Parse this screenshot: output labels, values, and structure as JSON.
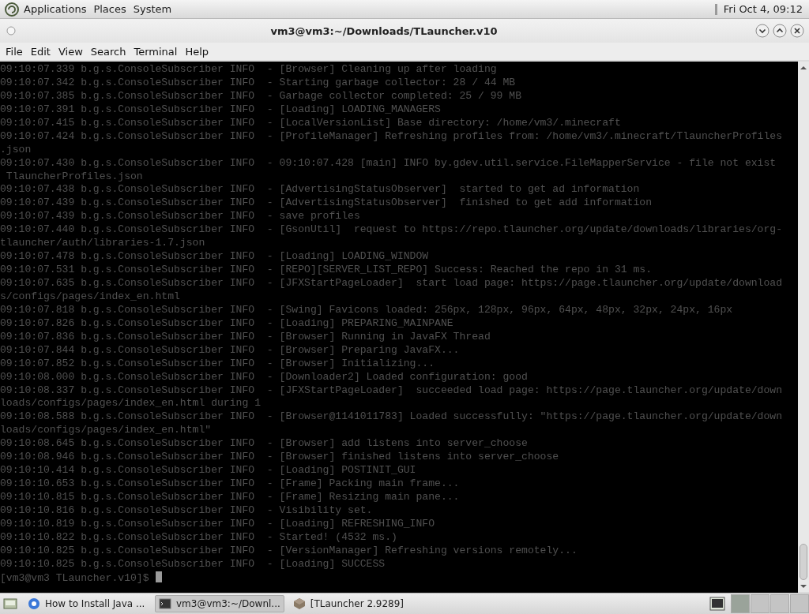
{
  "top_panel": {
    "menus": [
      "Applications",
      "Places",
      "System"
    ],
    "clock": "Fri Oct  4, 09:12"
  },
  "window": {
    "title": "vm3@vm3:~/Downloads/TLauncher.v10",
    "menu": [
      "File",
      "Edit",
      "View",
      "Search",
      "Terminal",
      "Help"
    ],
    "terminal": {
      "lines": [
        "09:10:07.339 b.g.s.ConsoleSubscriber INFO  - [Browser] Cleaning up after loading",
        "09:10:07.342 b.g.s.ConsoleSubscriber INFO  - Starting garbage collector: 28 / 44 MB",
        "09:10:07.385 b.g.s.ConsoleSubscriber INFO  - Garbage collector completed: 25 / 99 MB",
        "09:10:07.391 b.g.s.ConsoleSubscriber INFO  - [Loading] LOADING_MANAGERS",
        "09:10:07.415 b.g.s.ConsoleSubscriber INFO  - [LocalVersionList] Base directory: /home/vm3/.minecraft",
        "09:10:07.424 b.g.s.ConsoleSubscriber INFO  - [ProfileManager] Refreshing profiles from: /home/vm3/.minecraft/TlauncherProfiles",
        ".json",
        "09:10:07.430 b.g.s.ConsoleSubscriber INFO  - 09:10:07.428 [main] INFO by.gdev.util.service.FileMapperService - file not exist",
        " TlauncherProfiles.json",
        "09:10:07.438 b.g.s.ConsoleSubscriber INFO  - [AdvertisingStatusObserver]  started to get ad information",
        "09:10:07.439 b.g.s.ConsoleSubscriber INFO  - [AdvertisingStatusObserver]  finished to get add information",
        "09:10:07.439 b.g.s.ConsoleSubscriber INFO  - save profiles",
        "09:10:07.440 b.g.s.ConsoleSubscriber INFO  - [GsonUtil]  request to https://repo.tlauncher.org/update/downloads/libraries/org-",
        "tlauncher/auth/libraries-1.7.json",
        "09:10:07.478 b.g.s.ConsoleSubscriber INFO  - [Loading] LOADING_WINDOW",
        "09:10:07.531 b.g.s.ConsoleSubscriber INFO  - [REPO][SERVER_LIST_REPO] Success: Reached the repo in 31 ms.",
        "09:10:07.635 b.g.s.ConsoleSubscriber INFO  - [JFXStartPageLoader]  start load page: https://page.tlauncher.org/update/download",
        "s/configs/pages/index_en.html",
        "09:10:07.818 b.g.s.ConsoleSubscriber INFO  - [Swing] Favicons loaded: 256px, 128px, 96px, 64px, 48px, 32px, 24px, 16px",
        "09:10:07.826 b.g.s.ConsoleSubscriber INFO  - [Loading] PREPARING_MAINPANE",
        "09:10:07.836 b.g.s.ConsoleSubscriber INFO  - [Browser] Running in JavaFX Thread",
        "09:10:07.844 b.g.s.ConsoleSubscriber INFO  - [Browser] Preparing JavaFX...",
        "09:10:07.852 b.g.s.ConsoleSubscriber INFO  - [Browser] Initializing...",
        "09:10:08.000 b.g.s.ConsoleSubscriber INFO  - [Downloader2] Loaded configuration: good",
        "09:10:08.337 b.g.s.ConsoleSubscriber INFO  - [JFXStartPageLoader]  succeeded load page: https://page.tlauncher.org/update/down",
        "loads/configs/pages/index_en.html during 1",
        "09:10:08.588 b.g.s.ConsoleSubscriber INFO  - [Browser@1141011783] Loaded successfully: \"https://page.tlauncher.org/update/down",
        "loads/configs/pages/index_en.html\"",
        "09:10:08.645 b.g.s.ConsoleSubscriber INFO  - [Browser] add listens into server_choose",
        "09:10:08.946 b.g.s.ConsoleSubscriber INFO  - [Browser] finished listens into server_choose",
        "09:10:10.414 b.g.s.ConsoleSubscriber INFO  - [Loading] POSTINIT_GUI",
        "09:10:10.653 b.g.s.ConsoleSubscriber INFO  - [Frame] Packing main frame...",
        "09:10:10.815 b.g.s.ConsoleSubscriber INFO  - [Frame] Resizing main pane...",
        "09:10:10.816 b.g.s.ConsoleSubscriber INFO  - Visibility set.",
        "09:10:10.819 b.g.s.ConsoleSubscriber INFO  - [Loading] REFRESHING_INFO",
        "09:10:10.822 b.g.s.ConsoleSubscriber INFO  - Started! (4532 ms.)",
        "09:10:10.825 b.g.s.ConsoleSubscriber INFO  - [VersionManager] Refreshing versions remotely...",
        "09:10:10.825 b.g.s.ConsoleSubscriber INFO  - [Loading] SUCCESS"
      ],
      "prompt": "[vm3@vm3 TLauncher.v10]$"
    }
  },
  "taskbar": {
    "items": [
      {
        "kind": "browser",
        "label": "How to Install Java ...",
        "selected": false
      },
      {
        "kind": "terminal",
        "label": "vm3@vm3:~/Downl...",
        "selected": true
      },
      {
        "kind": "app",
        "label": "[TLauncher 2.9289]",
        "selected": false
      }
    ]
  }
}
